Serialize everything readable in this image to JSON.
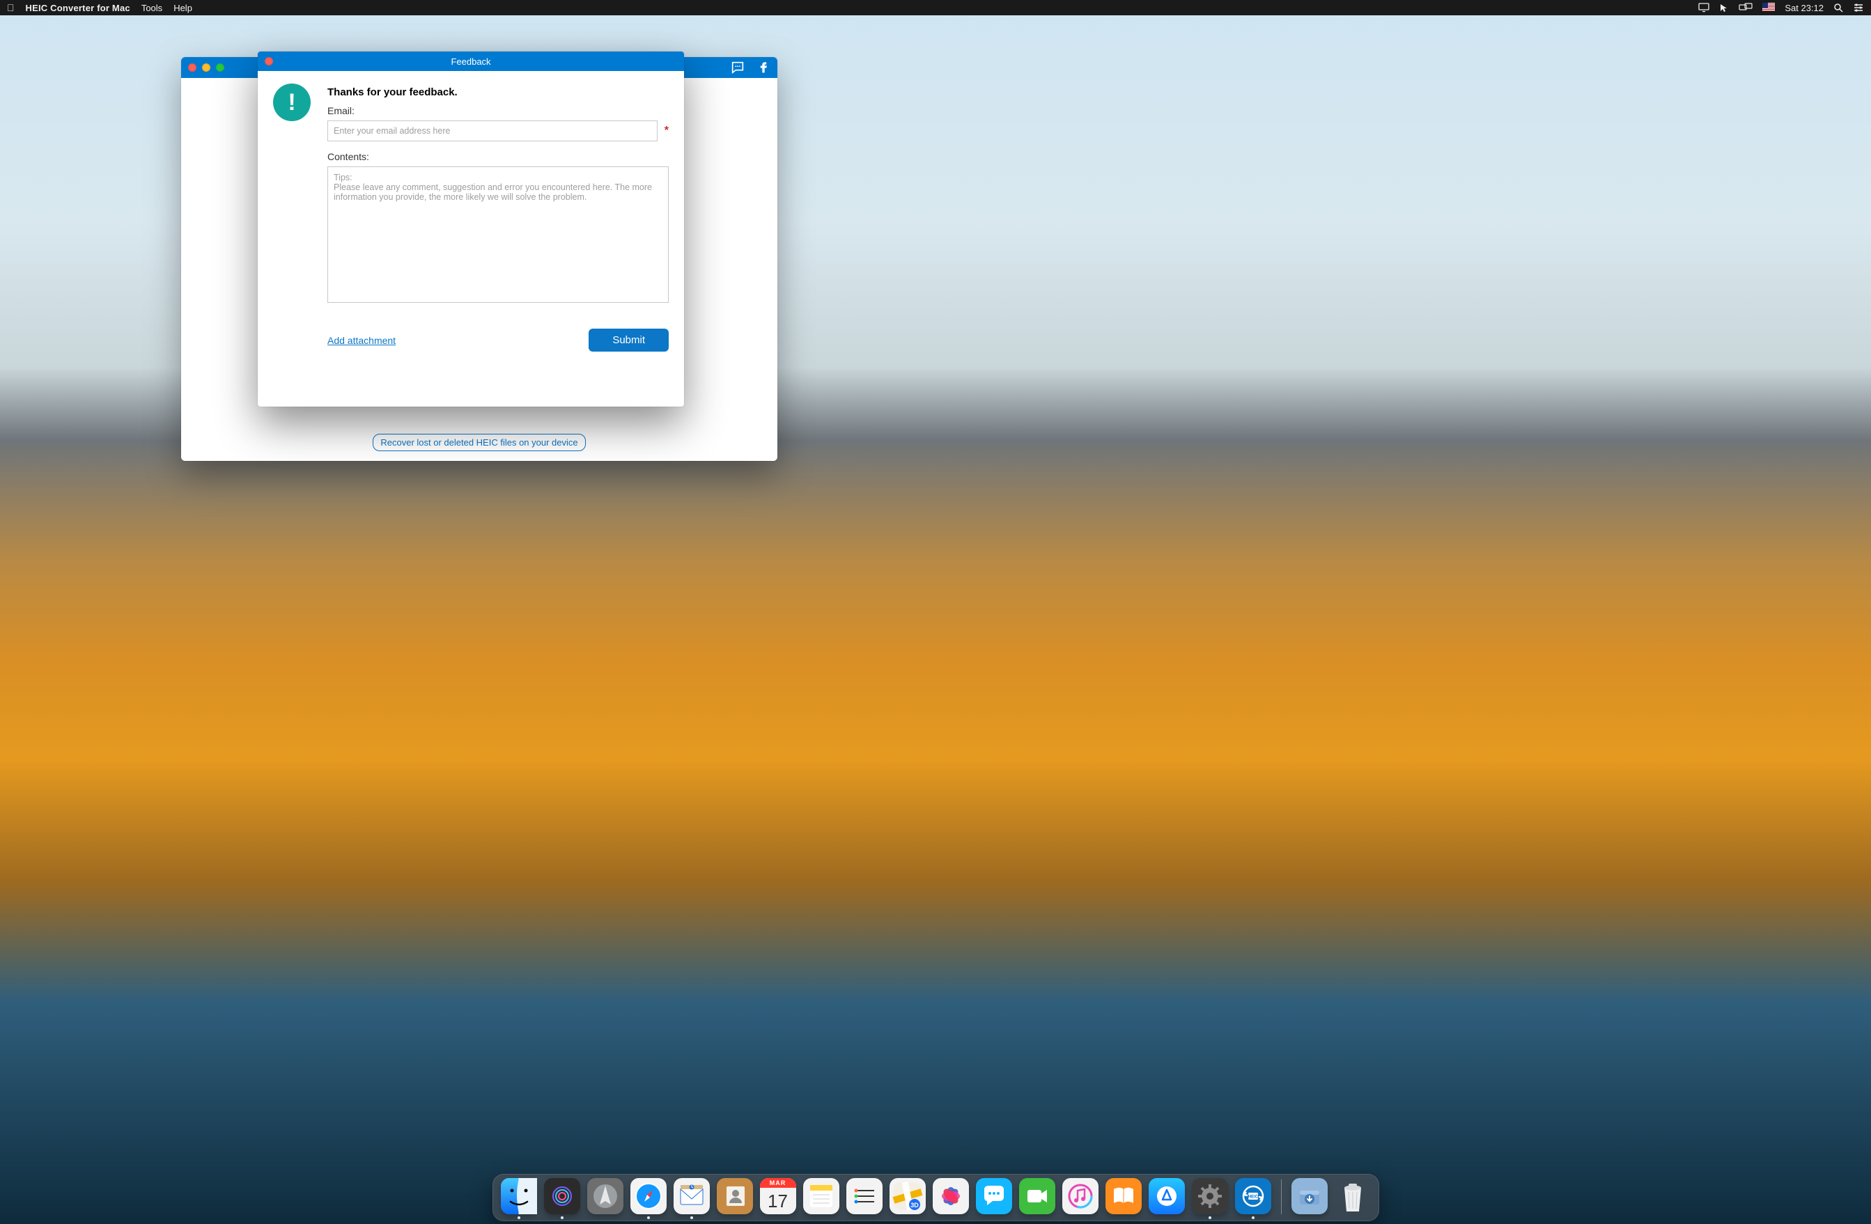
{
  "menubar": {
    "app_name": "HEIC Converter for Mac",
    "menus": [
      "Tools",
      "Help"
    ],
    "clock": "Sat 23:12"
  },
  "app_window": {
    "bottom_link": "Recover lost or deleted HEIC files on your device"
  },
  "feedback": {
    "title": "Feedback",
    "heading": "Thanks for your feedback.",
    "email_label": "Email:",
    "email_placeholder": "Enter your email address here",
    "required_mark": "*",
    "contents_label": "Contents:",
    "contents_placeholder": "Tips:\nPlease leave any comment, suggestion and error you encountered here. The more information you provide, the more likely we will solve the problem.",
    "add_attachment": "Add attachment",
    "submit": "Submit"
  },
  "dock": {
    "items": [
      {
        "name": "finder"
      },
      {
        "name": "siri"
      },
      {
        "name": "launchpad"
      },
      {
        "name": "safari"
      },
      {
        "name": "mail"
      },
      {
        "name": "contacts"
      },
      {
        "name": "calendar",
        "badge_top": "MAR",
        "badge_main": "17"
      },
      {
        "name": "notes"
      },
      {
        "name": "reminders"
      },
      {
        "name": "maps"
      },
      {
        "name": "photos"
      },
      {
        "name": "messages"
      },
      {
        "name": "facetime"
      },
      {
        "name": "music"
      },
      {
        "name": "ibooks"
      },
      {
        "name": "appstore"
      },
      {
        "name": "preferences"
      },
      {
        "name": "heic-converter"
      }
    ],
    "right_items": [
      {
        "name": "downloads"
      },
      {
        "name": "trash"
      }
    ]
  }
}
